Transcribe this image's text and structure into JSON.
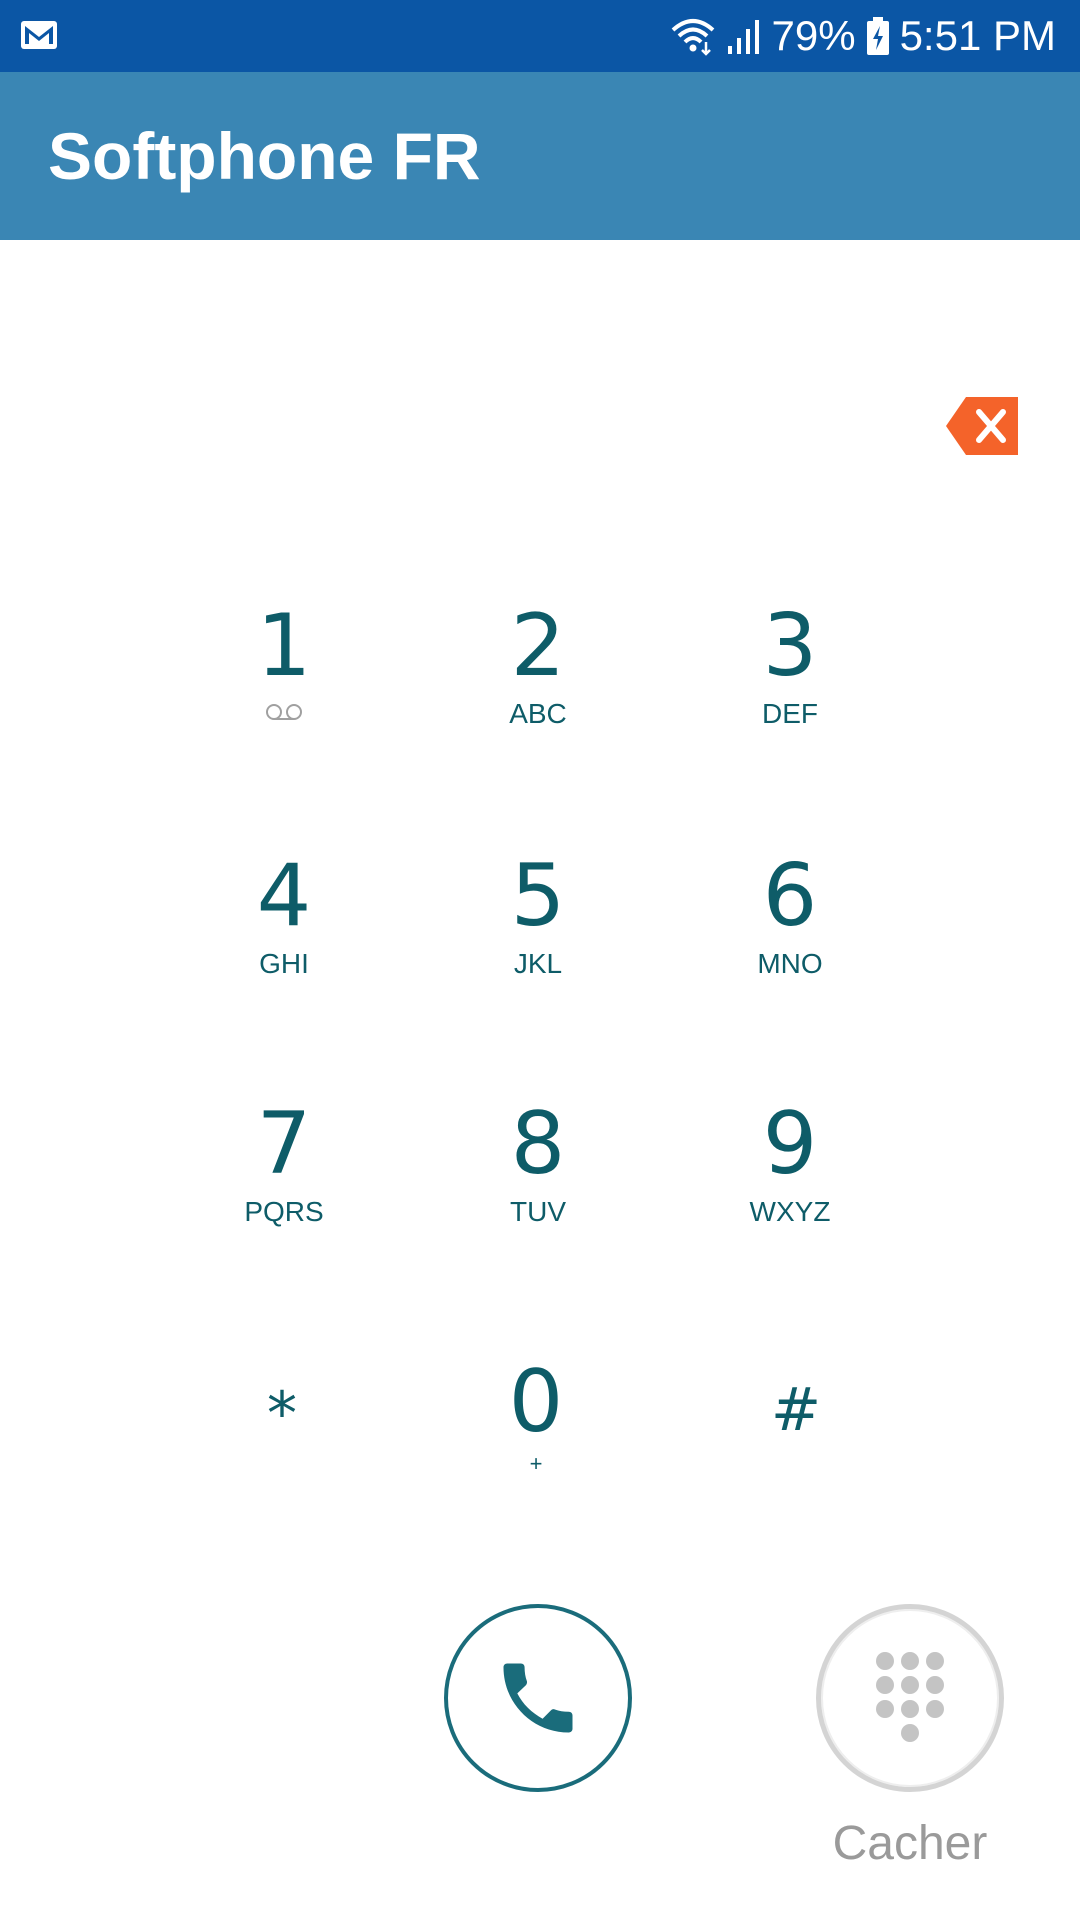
{
  "status_bar": {
    "battery": "79%",
    "time": "5:51 PM",
    "icons": [
      "gmail-icon",
      "wifi-icon",
      "signal-icon",
      "battery-charging-icon"
    ]
  },
  "app_bar": {
    "title": "Softphone FR"
  },
  "dialer": {
    "backspace_icon": "backspace-icon",
    "keys": [
      {
        "digit": "1",
        "letters": ""
      },
      {
        "digit": "2",
        "letters": "ABC"
      },
      {
        "digit": "3",
        "letters": "DEF"
      },
      {
        "digit": "4",
        "letters": "GHI"
      },
      {
        "digit": "5",
        "letters": "JKL"
      },
      {
        "digit": "6",
        "letters": "MNO"
      },
      {
        "digit": "7",
        "letters": "PQRS"
      },
      {
        "digit": "8",
        "letters": "TUV"
      },
      {
        "digit": "9",
        "letters": "WXYZ"
      },
      {
        "digit": "*",
        "letters": ""
      },
      {
        "digit": "0",
        "letters": "+"
      },
      {
        "digit": "#",
        "letters": ""
      }
    ],
    "call_icon": "phone-icon",
    "hide_label": "Cacher",
    "hide_icon": "dialpad-icon"
  },
  "colors": {
    "status_bar": "#0b56a5",
    "app_bar": "#3a86b4",
    "key_text": "#0e5c68",
    "backspace": "#f4632a",
    "call_ring": "#1a6c7b",
    "hide_grey": "#c4c4c4"
  }
}
